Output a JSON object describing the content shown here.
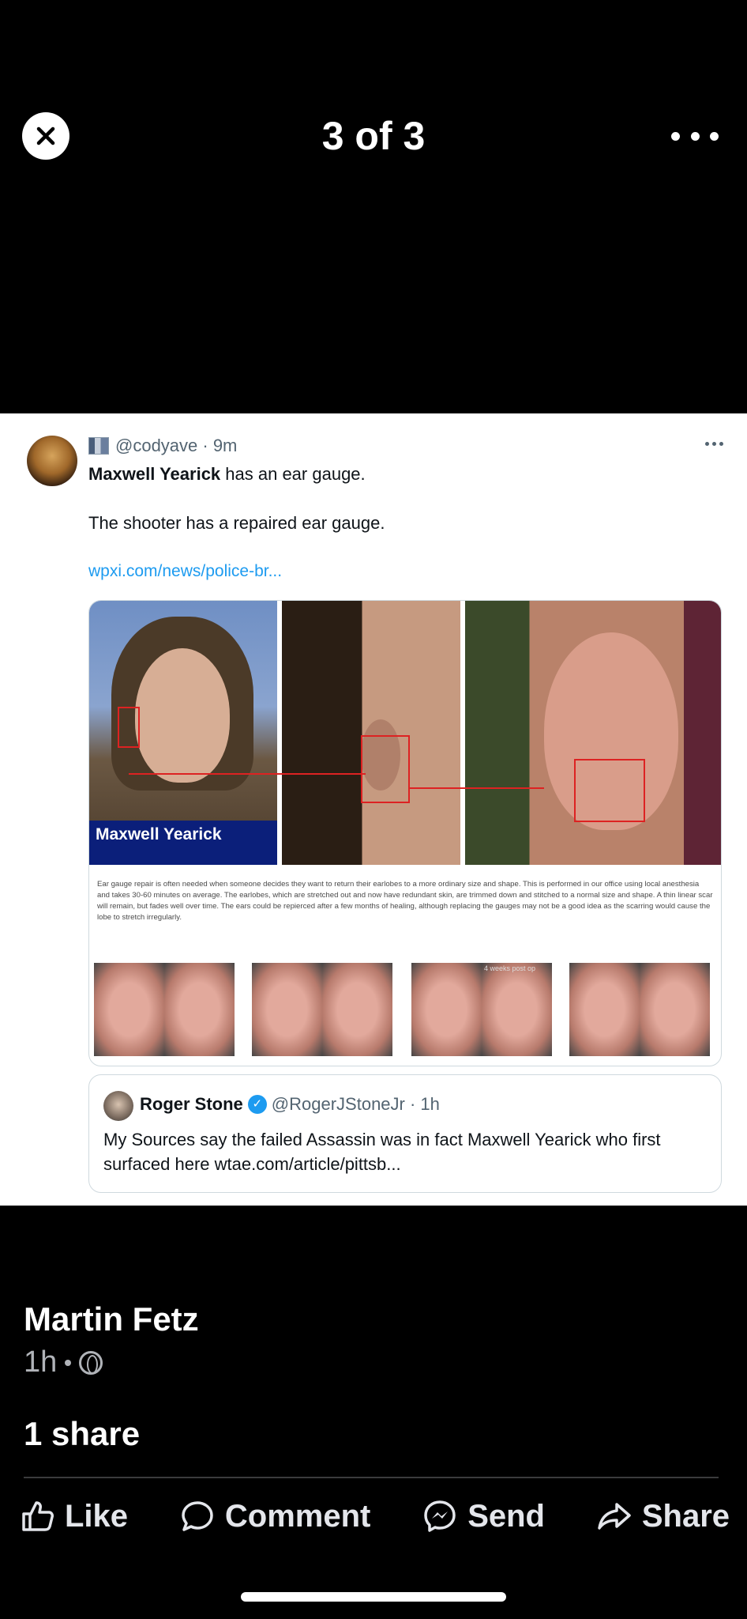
{
  "viewer": {
    "counter": "3 of 3"
  },
  "tweet": {
    "handle_meta": "@codyave · 9m",
    "line1_name": "Maxwell Yearick",
    "line1_rest": " has an ear gauge.",
    "line2": "The shooter has a repaired ear gauge.",
    "link": "wpxi.com/news/police-br...",
    "mugshot_caption": "Maxwell Yearick",
    "description": "Ear gauge repair is often needed when someone decides they want to return their earlobes to a more ordinary size and shape. This is performed in our office using local anesthesia and takes 30-60 minutes on average. The earlobes, which are stretched out and now have redundant skin, are trimmed down and stitched to a normal size and shape. A thin linear scar will remain, but fades well over time. The ears could be repierced after a few months of healing, although replacing the gauges may not be a good idea as the scarring would cause the lobe to stretch irregularly.",
    "thumb_overlay": "4 weeks post op",
    "quote": {
      "name": "Roger Stone",
      "handle_meta": "@RogerJStoneJr · 1h",
      "text": "My Sources say the failed Assassin was in fact Maxwell Yearick who first surfaced here  wtae.com/article/pittsb..."
    }
  },
  "post": {
    "author": "Martin Fetz",
    "time": "1h",
    "shares": "1 share"
  },
  "actions": {
    "like": "Like",
    "comment": "Comment",
    "send": "Send",
    "share": "Share"
  }
}
